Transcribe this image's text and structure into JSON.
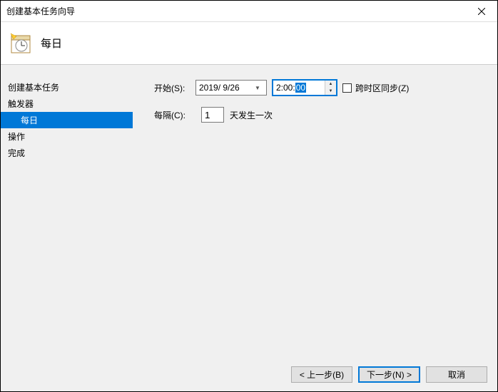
{
  "window": {
    "title": "创建基本任务向导"
  },
  "header": {
    "title": "每日"
  },
  "sidebar": {
    "items": [
      {
        "label": "创建基本任务",
        "sub": false,
        "active": false
      },
      {
        "label": "触发器",
        "sub": false,
        "active": false
      },
      {
        "label": "每日",
        "sub": true,
        "active": true
      },
      {
        "label": "操作",
        "sub": false,
        "active": false
      },
      {
        "label": "完成",
        "sub": false,
        "active": false
      }
    ]
  },
  "form": {
    "start_label": "开始(S):",
    "date_value": "2019/ 9/26",
    "time_prefix": "2:00:",
    "time_selected": "00",
    "sync_label": "跨时区同步(Z)",
    "recur_label": "每隔(C):",
    "recur_value": "1",
    "recur_suffix": "天发生一次"
  },
  "footer": {
    "back": "< 上一步(B)",
    "next": "下一步(N) >",
    "cancel": "取消"
  }
}
